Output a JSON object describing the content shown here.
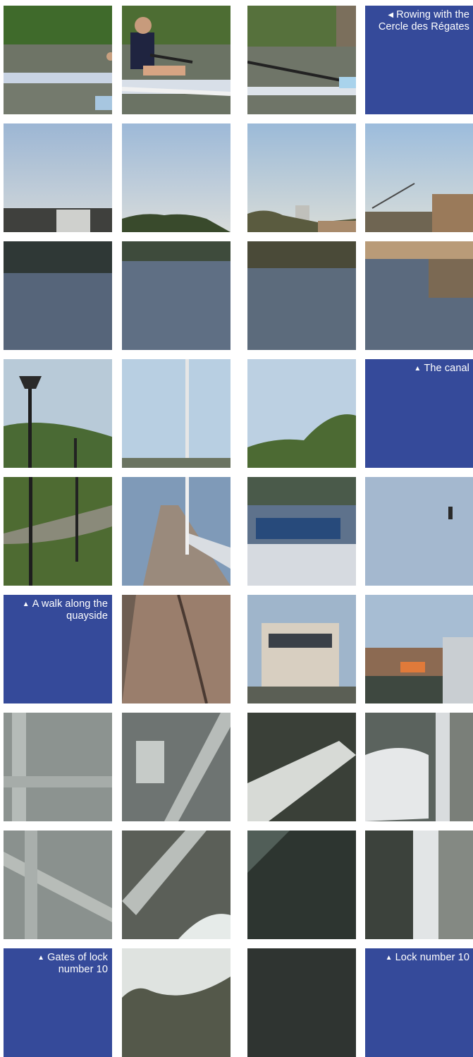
{
  "captions": {
    "rowing": {
      "arrow": "◀",
      "text": "Rowing with the Cercle des Régates"
    },
    "canal": {
      "arrow": "▲",
      "text": "The canal"
    },
    "walk": {
      "arrow": "▲",
      "text": "A walk along the quayside"
    },
    "gates": {
      "arrow": "▲",
      "text": "Gates of lock number 10"
    },
    "lock": {
      "arrow": "▲",
      "text": "Lock number 10"
    }
  },
  "colors": {
    "label_bg": "#354a9a",
    "label_text": "#ffffff",
    "page_bg": "#ffffff"
  },
  "icons": {
    "left_arrow": "caret-left-icon",
    "up_arrow": "caret-up-icon"
  }
}
